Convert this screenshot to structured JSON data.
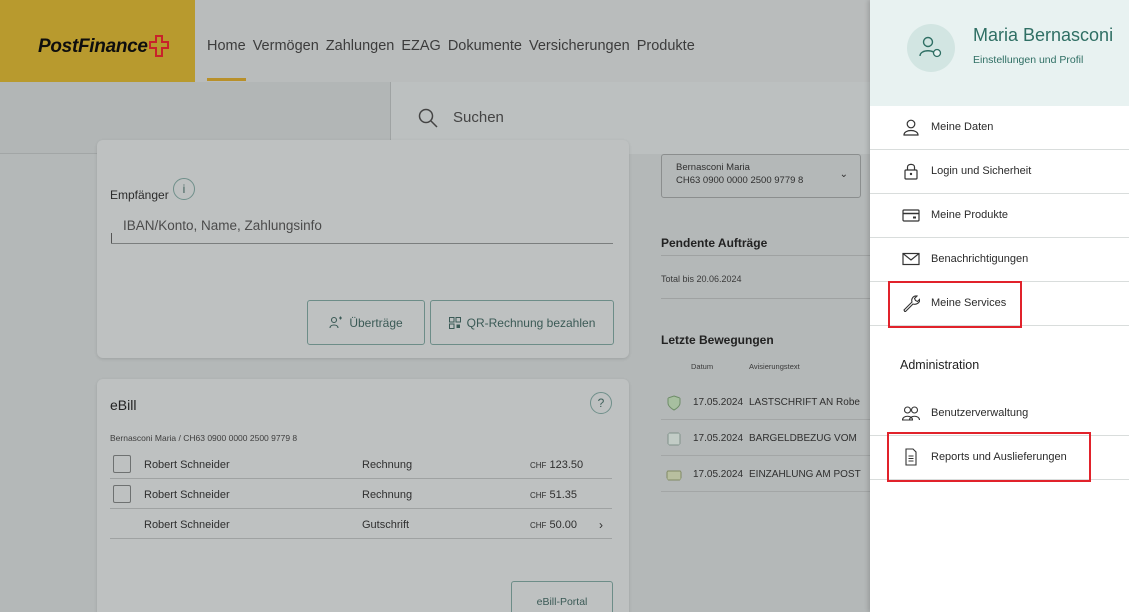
{
  "header": {
    "brand": "PostFinance",
    "nav": [
      "Home",
      "Vermögen",
      "Zahlungen",
      "EZAG",
      "Dokumente",
      "Versicherungen",
      "Produkte"
    ],
    "active_nav": "Home",
    "accent_color": "#b8902a"
  },
  "search": {
    "placeholder": "Suchen"
  },
  "payment": {
    "recipient_label": "Empfänger",
    "info_glyph": "i",
    "iban_placeholder": "IBAN/Konto, Name, Zahlungsinfo",
    "btn_transfers": "Überträge",
    "btn_qr": "QR-Rechnung bezahlen"
  },
  "ebill": {
    "title": "eBill",
    "help_glyph": "?",
    "account_line": "Bernasconi Maria / CH63 0900 0000 2500 9779 8",
    "rows": [
      {
        "name": "Robert Schneider",
        "type": "Rechnung",
        "currency": "CHF",
        "amount": "123.50",
        "checkbox": true
      },
      {
        "name": "Robert Schneider",
        "type": "Rechnung",
        "currency": "CHF",
        "amount": "51.35",
        "checkbox": true
      },
      {
        "name": "Robert Schneider",
        "type": "Gutschrift",
        "currency": "CHF",
        "amount": "50.00",
        "checkbox": false
      }
    ],
    "chevron": "›",
    "portal_button": "eBill-Portal"
  },
  "account_panel": {
    "account_name": "Bernasconi Maria",
    "account_iban": "CH63 0900 0000 2500 9779 8",
    "pending_title": "Pendente Aufträge",
    "pending_total": "Total bis 20.06.2024",
    "movements_title": "Letzte Bewegungen",
    "col_date": "Datum",
    "col_text": "Avisierungstext",
    "movements": [
      {
        "date": "17.05.2024",
        "text": "LASTSCHRIFT AN Robe",
        "icon": "shield-icon"
      },
      {
        "date": "17.05.2024",
        "text": "BARGELDBEZUG VOM",
        "icon": "cash-icon"
      },
      {
        "date": "17.05.2024",
        "text": "EINZAHLUNG AM POST",
        "icon": "deposit-icon"
      }
    ]
  },
  "profile": {
    "name": "Maria Bernasconi",
    "subtitle": "Einstellungen und Profil",
    "items": [
      {
        "label": "Meine Daten",
        "icon": "person-icon"
      },
      {
        "label": "Login und Sicherheit",
        "icon": "lock-icon"
      },
      {
        "label": "Meine Produkte",
        "icon": "card-icon"
      },
      {
        "label": "Benachrichtigungen",
        "icon": "mail-icon"
      },
      {
        "label": "Meine Services",
        "icon": "wrench-icon"
      }
    ],
    "admin_title": "Administration",
    "admin_items": [
      {
        "label": "Benutzerverwaltung",
        "icon": "users-icon"
      },
      {
        "label": "Reports und Auslieferungen",
        "icon": "report-icon"
      }
    ],
    "highlight_color": "#e1222b"
  }
}
